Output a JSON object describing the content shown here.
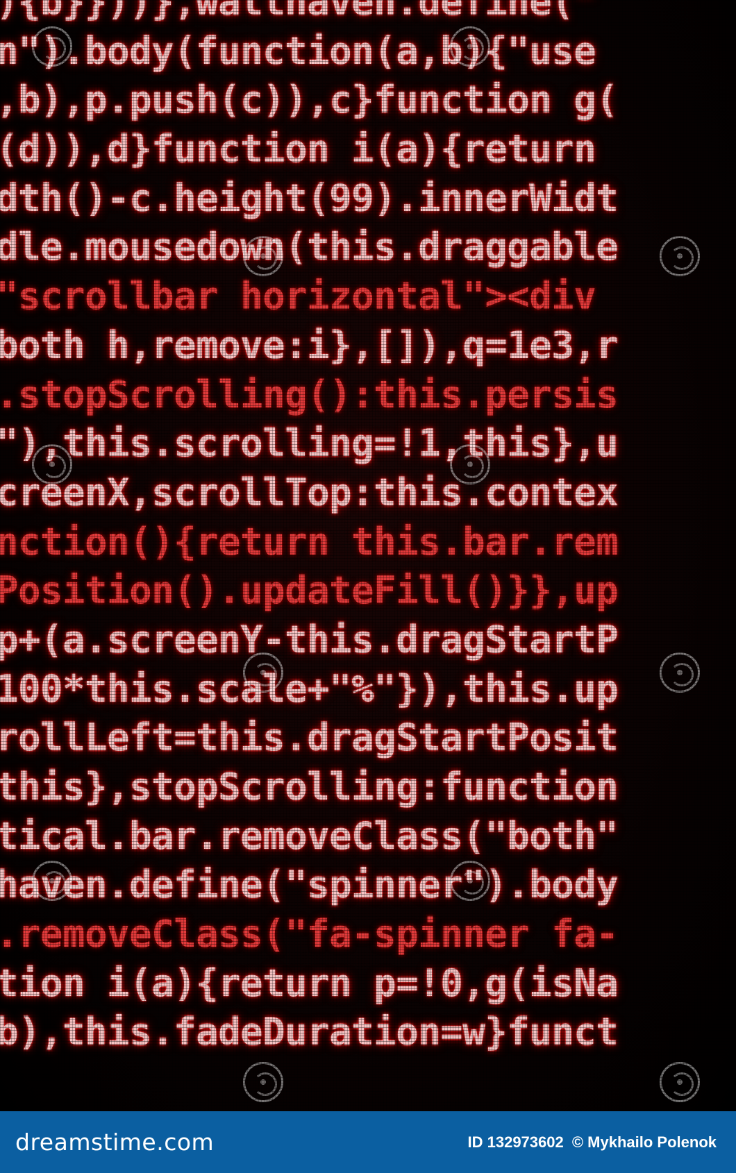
{
  "code_lines": [
    "){b}}))},wallhaven.define(\"",
    "n\").body(function(a,b){\"use",
    ",b),p.push(c)),c}function g(",
    "(d)),d}function i(a){return ",
    "dth()-c.height(99).innerWidt",
    "dle.mousedown(this.draggable",
    "\"scrollbar horizontal\"><div",
    "both h,remove:i},[]),q=1e3,r",
    ".stopScrolling():this.persis",
    "\"),this.scrolling=!1,this},u",
    "creenX,scrollTop:this.contex",
    "nction(){return this.bar.rem",
    "Position().updateFill()}},up",
    "p+(a.screenY-this.dragStartP",
    "100*this.scale+\"%\"}),this.up",
    "rollLeft=this.dragStartPosit",
    "this},stopScrolling:function",
    "tical.bar.removeClass(\"both\"",
    "haven.define(\"spinner\").body",
    ".removeClass(\"fa-spinner fa-",
    "tion i(a){return p=!0,g(isNa",
    "b),this.fadeDuration=w}funct"
  ],
  "footer": {
    "logo": "dreamstime.com",
    "id_label": "ID 132973602",
    "copyright": "© Mykhailo Polenok"
  },
  "colors": {
    "code_glow": "#e01010",
    "code_text": "#f5c2c2",
    "footer_bg": "#0b5fa1"
  },
  "icons": [
    "dreamstime-watermark-icon"
  ]
}
